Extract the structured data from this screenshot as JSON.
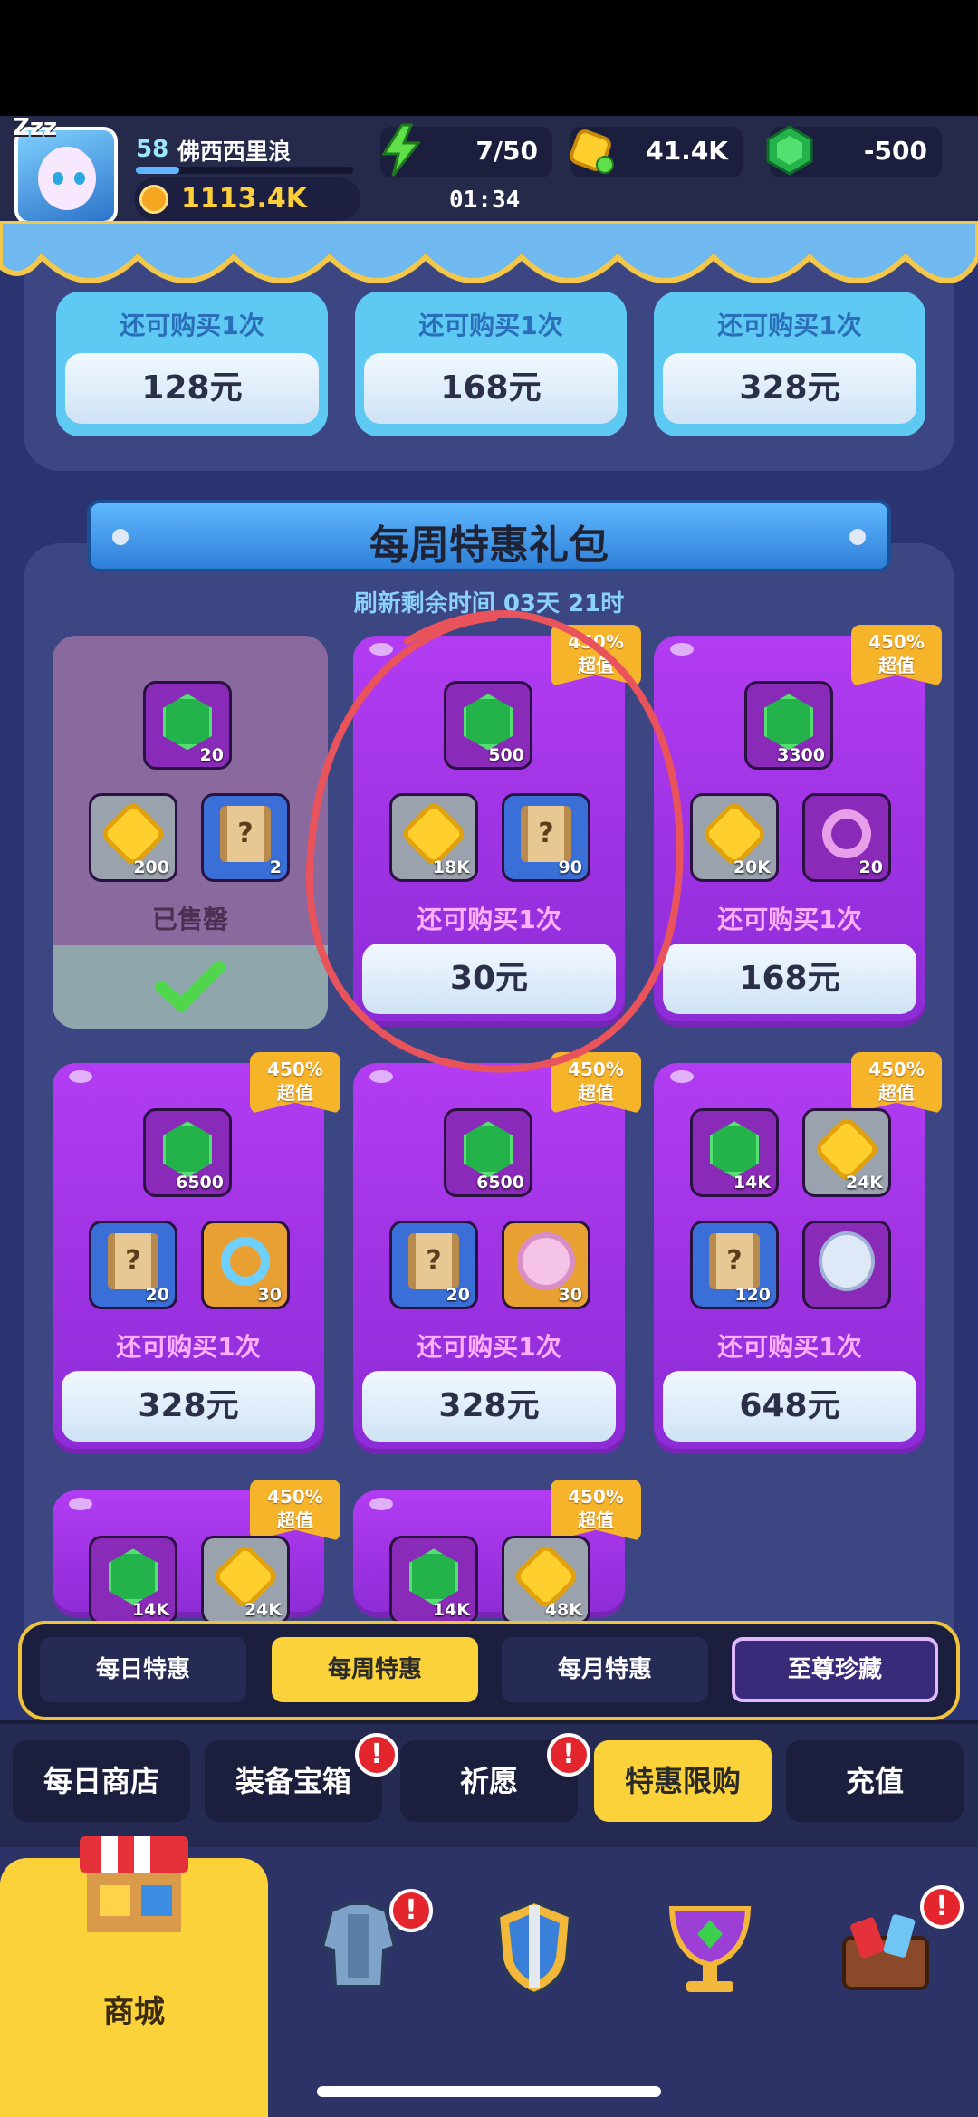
{
  "header": {
    "zzz": "Zzz",
    "level": "58",
    "player_name": "佛西西里浪",
    "power": "1113.4K",
    "timer": "01:34",
    "resources": [
      {
        "icon": "energy-bolt-icon",
        "value": "7/50"
      },
      {
        "icon": "gold-coin-icon",
        "value": "41.4K"
      },
      {
        "icon": "green-gem-icon",
        "value": "-500"
      }
    ]
  },
  "top_packs": [
    {
      "limit": "还可购买1次",
      "price": "128元"
    },
    {
      "limit": "还可购买1次",
      "price": "168元"
    },
    {
      "limit": "还可购买1次",
      "price": "328元"
    }
  ],
  "weekly": {
    "title": "每周特惠礼包",
    "refresh": "刷新剩余时间 03天 21时",
    "sold_out": {
      "label": "已售罄",
      "items": [
        {
          "icon": "green-gem-icon",
          "count": "20"
        },
        {
          "icon": "gold-coin-icon",
          "count": "200"
        },
        {
          "icon": "scroll-icon",
          "count": "2"
        }
      ]
    },
    "packs": [
      {
        "badge": "450%\n超值",
        "limit": "还可购买1次",
        "price": "30元",
        "items": [
          {
            "icon": "green-gem-icon",
            "count": "500"
          },
          {
            "icon": "gold-coin-icon",
            "count": "18K"
          },
          {
            "icon": "scroll-icon",
            "count": "90"
          }
        ]
      },
      {
        "badge": "450%\n超值",
        "limit": "还可购买1次",
        "price": "168元",
        "items": [
          {
            "icon": "green-gem-icon",
            "count": "3300"
          },
          {
            "icon": "gold-coin-icon",
            "count": "20K"
          },
          {
            "icon": "key-icon",
            "count": "20"
          }
        ]
      },
      {
        "badge": "450%\n超值",
        "limit": "还可购买1次",
        "price": "328元",
        "items": [
          {
            "icon": "green-gem-icon",
            "count": "6500"
          },
          {
            "icon": "scroll-icon",
            "count": "20"
          },
          {
            "icon": "key-icon",
            "count": "30"
          }
        ]
      },
      {
        "badge": "450%\n超值",
        "limit": "还可购买1次",
        "price": "328元",
        "items": [
          {
            "icon": "green-gem-icon",
            "count": "6500"
          },
          {
            "icon": "scroll-icon",
            "count": "20"
          },
          {
            "icon": "medal-icon",
            "count": "30"
          }
        ]
      },
      {
        "badge": "450%\n超值",
        "limit": "还可购买1次",
        "price": "648元",
        "items": [
          {
            "icon": "green-gem-icon",
            "count": "14K"
          },
          {
            "icon": "gold-coin-icon",
            "count": "24K"
          },
          {
            "icon": "scroll-icon",
            "count": "120"
          },
          {
            "icon": "hero-portrait-icon",
            "count": ""
          }
        ]
      },
      {
        "badge": "450%\n超值",
        "limit": "",
        "price": "",
        "items": [
          {
            "icon": "green-gem-icon",
            "count": "14K"
          },
          {
            "icon": "gold-coin-icon",
            "count": "24K"
          }
        ]
      },
      {
        "badge": "450%\n超值",
        "limit": "",
        "price": "",
        "items": [
          {
            "icon": "green-gem-icon",
            "count": "14K"
          },
          {
            "icon": "gold-coin-icon",
            "count": "48K"
          }
        ]
      }
    ]
  },
  "sub_tabs": [
    {
      "label": "每日特惠",
      "active": false
    },
    {
      "label": "每周特惠",
      "active": true
    },
    {
      "label": "每月特惠",
      "active": false
    },
    {
      "label": "至尊珍藏",
      "active": false
    }
  ],
  "shop_tabs": [
    {
      "label": "每日商店",
      "alert": false
    },
    {
      "label": "装备宝箱",
      "alert": true
    },
    {
      "label": "祈愿",
      "alert": true
    },
    {
      "label": "特惠限购",
      "alert": false,
      "active": true
    },
    {
      "label": "充值",
      "alert": false
    }
  ],
  "alert_mark": "!",
  "bottom_nav": [
    {
      "label": "商城",
      "icon": "shop-stall-icon",
      "active": true
    },
    {
      "label": "",
      "icon": "armor-icon",
      "alert": true
    },
    {
      "label": "",
      "icon": "shield-sword-icon"
    },
    {
      "label": "",
      "icon": "trophy-cup-icon"
    },
    {
      "label": "",
      "icon": "hammer-anvil-icon",
      "alert": true
    }
  ],
  "colors": {
    "background": "#2b3470",
    "panel": "#3b4683",
    "pack_purple": "#b23cf2",
    "accent_yellow": "#fbd23a",
    "annotation_red": "#e8535c"
  }
}
